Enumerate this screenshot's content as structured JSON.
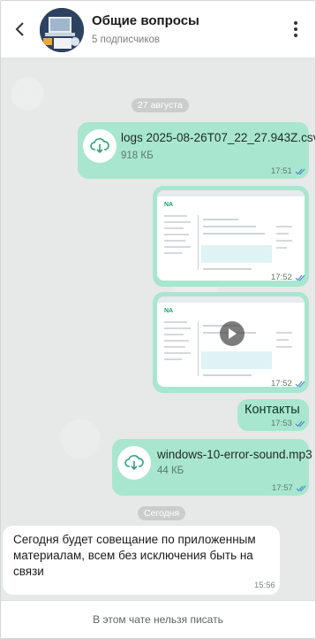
{
  "header": {
    "title": "Общие вопросы",
    "subtitle": "5 подписчиков"
  },
  "dates": {
    "first": "27 августа",
    "today": "Сегодня"
  },
  "messages": {
    "csv": {
      "file_name": "logs 2025-08-26T07_22_27.943Z.csv",
      "file_size": "918 КБ",
      "time": "17:51"
    },
    "img1": {
      "time": "17:52"
    },
    "video": {
      "time": "17:52"
    },
    "contacts": {
      "text": "Контакты",
      "time": "17:53"
    },
    "mp3": {
      "file_name": "windows-10-error-sound.mp3",
      "file_size": "44 КБ",
      "time": "17:57"
    },
    "incoming": {
      "text": "Сегодня будет совещание по приложенным материалам, всем без исключения быть на связи",
      "time": "15:56"
    }
  },
  "footer": {
    "text": "В этом чате нельзя писать"
  },
  "colors": {
    "outgoing_bubble": "#a8e6cf",
    "incoming_bubble": "#ffffff",
    "accent": "#14a36b"
  },
  "icons": [
    "back-arrow-icon",
    "more-vertical-icon",
    "download-icon",
    "double-check-icon",
    "play-icon"
  ]
}
